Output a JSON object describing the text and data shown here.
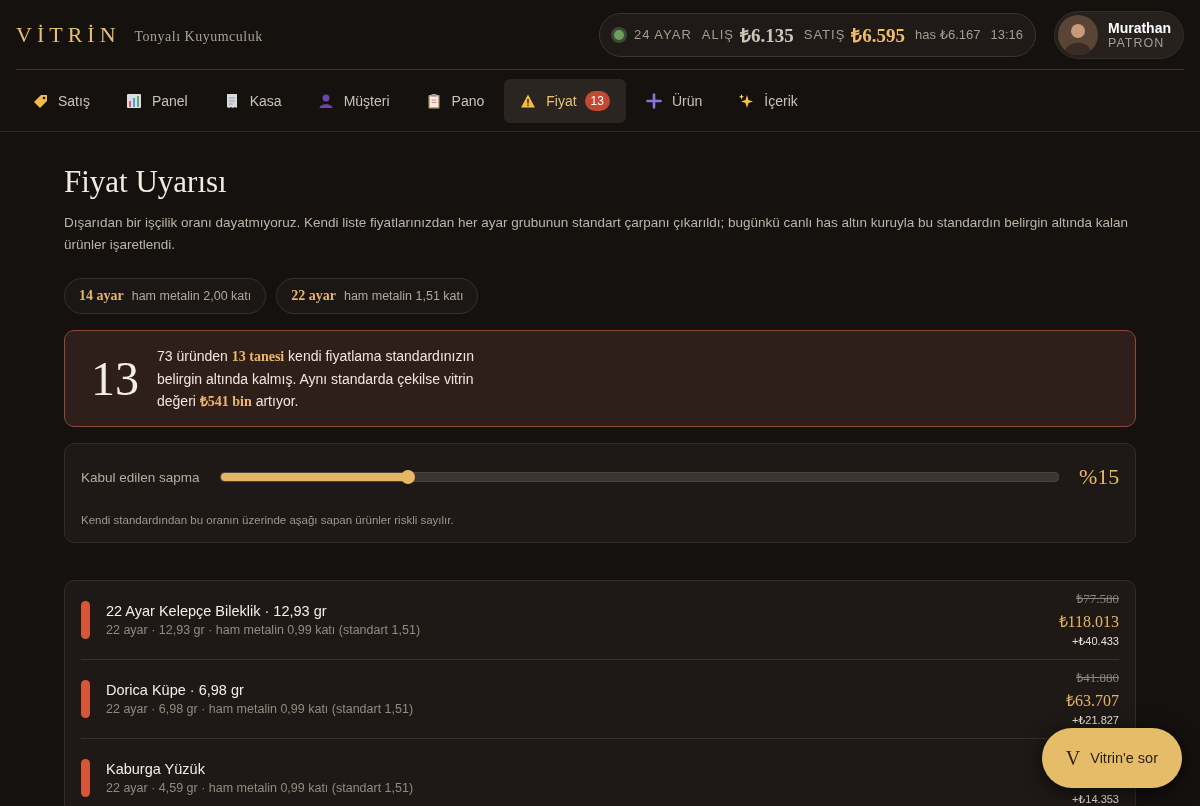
{
  "brand": {
    "logo": "VİTRİN",
    "shop": "Tonyalı Kuyumculuk"
  },
  "ticker": {
    "live": true,
    "karat": "24 AYAR",
    "buy_label": "ALIŞ",
    "buy": "₺6.135",
    "sell_label": "SATIŞ",
    "sell": "₺6.595",
    "has": "has ₺6.167",
    "time": "13:16"
  },
  "user": {
    "name": "Murathan",
    "role": "PATRON"
  },
  "tabs": [
    {
      "kind": "tag",
      "label": "Satış",
      "selected": false
    },
    {
      "kind": "chart",
      "label": "Panel",
      "selected": false
    },
    {
      "kind": "receipt",
      "label": "Kasa",
      "selected": false
    },
    {
      "kind": "person",
      "label": "Müşteri",
      "selected": false
    },
    {
      "kind": "clipboard",
      "label": "Pano",
      "selected": false
    },
    {
      "kind": "warning",
      "label": "Fiyat",
      "selected": true,
      "badge": "13"
    },
    {
      "kind": "plus",
      "label": "Ürün",
      "selected": false
    },
    {
      "kind": "sparkle",
      "label": "İçerik",
      "selected": false
    }
  ],
  "page": {
    "title": "Fiyat Uyarısı",
    "description": "Dışarıdan bir işçilik oranı dayatmıyoruz. Kendi liste fiyatlarınızdan her ayar grubunun standart çarpanı çıkarıldı; bugünkü canlı has altın kuruyla bu standardın belirgin altında kalan ürünler işaretlendi."
  },
  "standards": [
    {
      "karat": "14 ayar",
      "text": "ham metalin 2,00 katı"
    },
    {
      "karat": "22 ayar",
      "text": "ham metalin 1,51 katı"
    }
  ],
  "summary": {
    "count": "13",
    "text": "73 üründen **13 tanesi** kendi fiyatlama standardınızın belirgin altında kalmış. Aynı standarda çekilse vitrin değeri **₺541 bin** artıyor."
  },
  "tolerance": {
    "label": "Kabul edilen sapma",
    "level": 0.224,
    "reading": "%15",
    "note": "Kendi standardından bu oranın üzerinde aşağı sapan ürünler riskli sayılır."
  },
  "products": [
    {
      "name": "22 Ayar Kelepçe Bileklik · 12,93 gr",
      "detail": "22 ayar · 12,93 gr · ham metalin 0,99 katı (standart 1,51)",
      "old_price": "₺77.580",
      "new_price": "₺118.013",
      "delta": "+₺40.433"
    },
    {
      "name": "Dorica Küpe · 6,98 gr",
      "detail": "22 ayar · 6,98 gr · ham metalin 0,99 katı (standart 1,51)",
      "old_price": "₺41.880",
      "new_price": "₺63.707",
      "delta": "+₺21.827"
    },
    {
      "name": "Kaburga Yüzük",
      "detail": "22 ayar · 4,59 gr · ham metalin 0,99 katı (standart 1,51)",
      "delta": "+₺14.353"
    }
  ],
  "assistant": {
    "mark": "V",
    "label": "Vitrin'e sor"
  }
}
